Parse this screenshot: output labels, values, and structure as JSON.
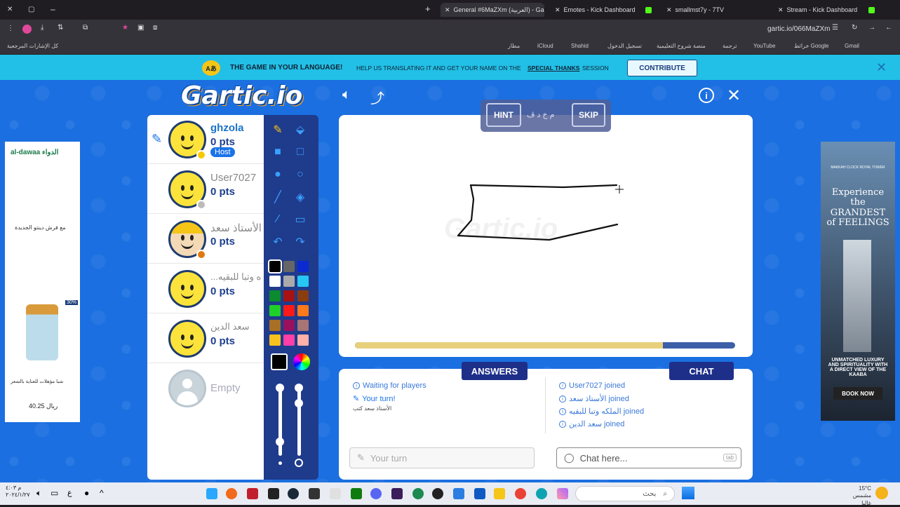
{
  "browser": {
    "tabs": [
      {
        "label": "General #6MaZXm (العربية) - Gartic.io"
      },
      {
        "label": "Emotes - Kick Dashboard"
      },
      {
        "label": "smallmst7y - 7TV"
      },
      {
        "label": "Stream - Kick Dashboard"
      }
    ],
    "address": "gartic.io/066MaZXm",
    "bookmarks": [
      "كل الإشارات المرجعية",
      "مطار",
      "iCloud",
      "Shahid",
      "تسجيل الدخول",
      "منصة شروح التعليمية",
      "ترجمة",
      "YouTube",
      "خرائط Google",
      "Gmail"
    ]
  },
  "banner": {
    "title": "THE GAME IN YOUR LANGUAGE!",
    "text": "HELP US TRANSLATING IT AND GET YOUR NAME ON THE",
    "link": "SPECIAL THANKS",
    "text2": "SESSION",
    "button": "CONTRIBUTE"
  },
  "logo": "Gartic.io",
  "players": [
    {
      "name": "ghzola",
      "pts": "0 pts",
      "host": "Host",
      "status_color": "#f7c900"
    },
    {
      "name": "User7027",
      "pts": "0 pts",
      "status_color": "#bbbbbb"
    },
    {
      "name": "الأستاذ سعد",
      "pts": "0 pts",
      "status_color": "#e07a10"
    },
    {
      "name": "...ه وتبا للبقيه",
      "pts": "0 pts",
      "status_color": ""
    },
    {
      "name": "سعد الدين",
      "pts": "0 pts",
      "status_color": ""
    },
    {
      "name": "Empty",
      "pts": ""
    }
  ],
  "palette": [
    "#000000",
    "#666666",
    "#0b2bd1",
    "#ffffff",
    "#aaaaaa",
    "#26c7f5",
    "#0c8a2f",
    "#a81212",
    "#8a3d10",
    "#1fcf2a",
    "#ff1a1a",
    "#ff7a1a",
    "#a87024",
    "#99105f",
    "#a87474",
    "#f7c21f",
    "#ff3fa8",
    "#ffb0a8"
  ],
  "hint": {
    "hint_label": "HINT",
    "letters": "م خ د ڤ",
    "skip_label": "SKIP"
  },
  "progress": 0.81,
  "tabs": {
    "answers": "ANSWERS",
    "chat": "CHAT"
  },
  "answers_log": [
    {
      "text": "Waiting for players"
    },
    {
      "text": "Your turn!"
    },
    {
      "text": "الأستاذ سعد كتب"
    }
  ],
  "chat_log": [
    {
      "text": "User7027 joined"
    },
    {
      "text": "الأستاذ سعد joined"
    },
    {
      "text": "الملكه وتبا للبقيه joined"
    },
    {
      "text": "سعد الدين joined"
    }
  ],
  "inputs": {
    "answer_placeholder": "Your turn",
    "chat_placeholder": "Chat here...",
    "tab_hint": "tab"
  },
  "ads": {
    "left_brand": "al-dawaa الدواء",
    "left_text": "مع فرش دينتو الجديدة",
    "left_badge": "30%",
    "left_product": "شبا مؤهلات للعناية بالشعر",
    "left_price": "40.25 ريال",
    "right_small": "MAKKAH CLOCK ROYAL TOWER",
    "right_title": "Experience the GRANDEST of FEELINGS",
    "right_sub": "UNMATCHED LUXURY AND SPIRITUALITY WITH A DIRECT VIEW OF THE KAABA",
    "right_cta": "BOOK NOW"
  },
  "taskbar": {
    "search_placeholder": "بحث",
    "weather": "15°C مشمس غالبا",
    "clock_time": "م ٤:٠٣",
    "clock_date": "٢٠٢٤/١/٢٧"
  }
}
